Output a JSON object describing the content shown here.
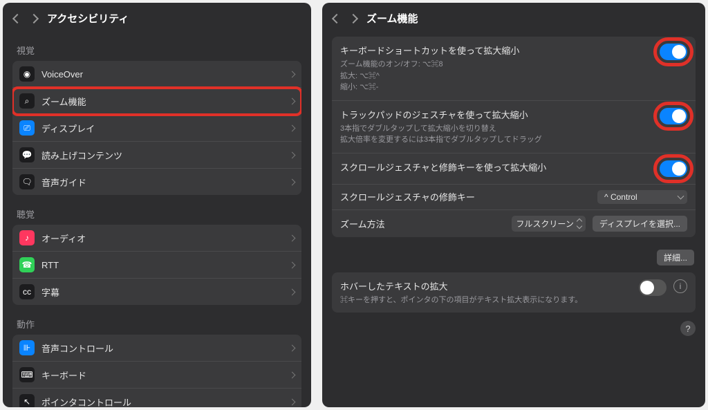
{
  "left": {
    "title": "アクセシビリティ",
    "sections": [
      {
        "label": "視覚",
        "items": [
          {
            "label": "VoiceOver",
            "iconClass": "icon-dark",
            "glyph": "◉",
            "name": "voiceover"
          },
          {
            "label": "ズーム機能",
            "iconClass": "icon-dark",
            "glyph": "⌕",
            "name": "zoom",
            "highlighted": true
          },
          {
            "label": "ディスプレイ",
            "iconClass": "icon-blue",
            "glyph": "⎚",
            "name": "display"
          },
          {
            "label": "読み上げコンテンツ",
            "iconClass": "icon-dark",
            "glyph": "💬",
            "name": "spoken-content"
          },
          {
            "label": "音声ガイド",
            "iconClass": "icon-dark",
            "glyph": "🗨",
            "name": "audio-descriptions"
          }
        ]
      },
      {
        "label": "聴覚",
        "items": [
          {
            "label": "オーディオ",
            "iconClass": "icon-pink",
            "glyph": "♪",
            "name": "audio"
          },
          {
            "label": "RTT",
            "iconClass": "icon-green",
            "glyph": "☎",
            "name": "rtt"
          },
          {
            "label": "字幕",
            "iconClass": "icon-dark",
            "glyph": "cc",
            "name": "subtitles"
          }
        ]
      },
      {
        "label": "動作",
        "items": [
          {
            "label": "音声コントロール",
            "iconClass": "icon-blue",
            "glyph": "⊪",
            "name": "voice-control"
          },
          {
            "label": "キーボード",
            "iconClass": "icon-dark",
            "glyph": "⌨",
            "name": "keyboard"
          },
          {
            "label": "ポインタコントロール",
            "iconClass": "icon-dark",
            "glyph": "↖",
            "name": "pointer-control"
          }
        ]
      }
    ]
  },
  "right": {
    "title": "ズーム機能",
    "s1_title": "キーボードショートカットを使って拡大縮小",
    "s1_sub": "ズーム機能のオン/オフ: ⌥⌘8\n拡大: ⌥⌘^\n縮小: ⌥⌘-",
    "s2_title": "トラックパッドのジェスチャを使って拡大縮小",
    "s2_sub": "3本指でダブルタップして拡大縮小を切り替え\n拡大倍率を変更するには3本指でダブルタップしてドラッグ",
    "s3_title": "スクロールジェスチャと修飾キーを使って拡大縮小",
    "scroll_modifier_label": "スクロールジェスチャの修飾キー",
    "scroll_modifier_value": "^ Control",
    "zoom_method_label": "ズーム方法",
    "zoom_method_value": "フルスクリーン",
    "choose_display": "ディスプレイを選択...",
    "advanced": "詳細...",
    "hover_title": "ホバーしたテキストの拡大",
    "hover_sub": "⌘キーを押すと、ポインタの下の項目がテキスト拡大表示になります。"
  }
}
